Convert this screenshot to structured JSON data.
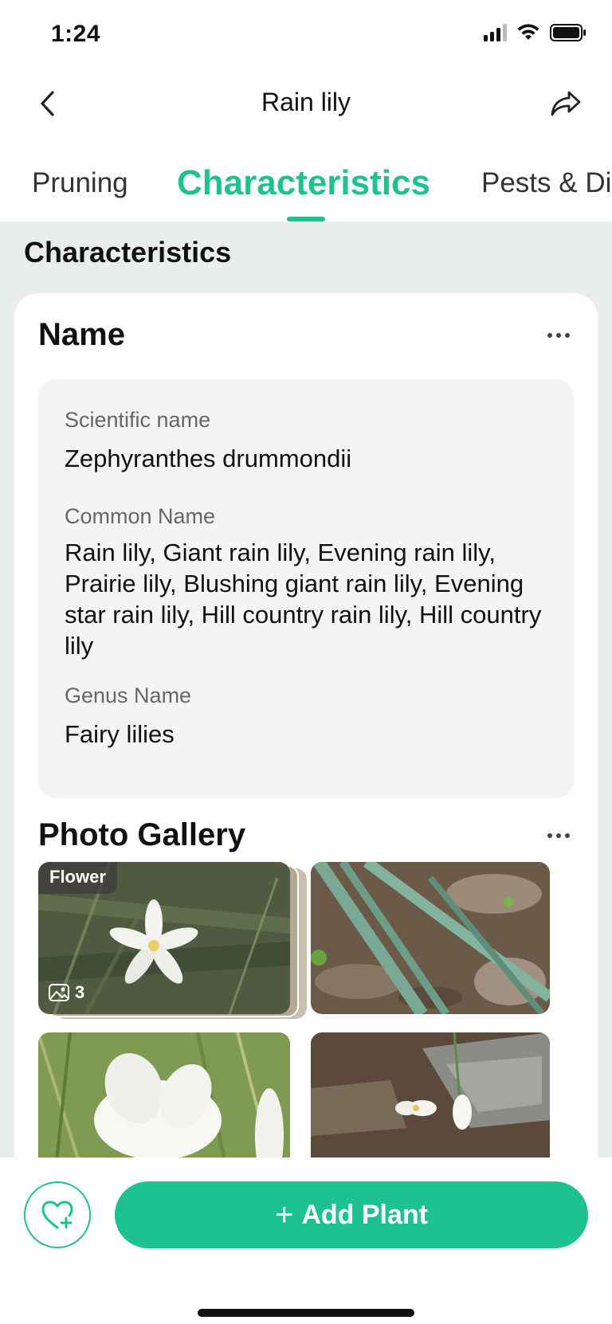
{
  "status_bar": {
    "time": "1:24"
  },
  "nav": {
    "title": "Rain lily"
  },
  "tabs": [
    {
      "label": "Pruning",
      "active": false
    },
    {
      "label": "Characteristics",
      "active": true
    },
    {
      "label": "Pests & Di",
      "active": false
    }
  ],
  "section": {
    "title": "Characteristics"
  },
  "name_card": {
    "title": "Name",
    "fields": [
      {
        "label": "Scientific name",
        "value": "Zephyranthes drummondii"
      },
      {
        "label": "Common Name",
        "value": "Rain lily, Giant rain lily, Evening rain lily, Prairie lily, Blushing giant rain lily, Evening star rain lily, Hill country rain lily, Hill country lily"
      },
      {
        "label": "Genus Name",
        "value": "Fairy lilies"
      }
    ]
  },
  "gallery": {
    "title": "Photo Gallery",
    "photos": [
      {
        "tag": "Flower",
        "count": "3"
      },
      {
        "tag": "",
        "count": ""
      },
      {
        "tag": "",
        "count": ""
      },
      {
        "tag": "",
        "count": ""
      }
    ]
  },
  "bottom_bar": {
    "add_label": "Add Plant"
  },
  "colors": {
    "accent": "#1ec28f",
    "background": "#e9eeec",
    "card": "#ffffff",
    "info_box": "#f3f5f4"
  }
}
